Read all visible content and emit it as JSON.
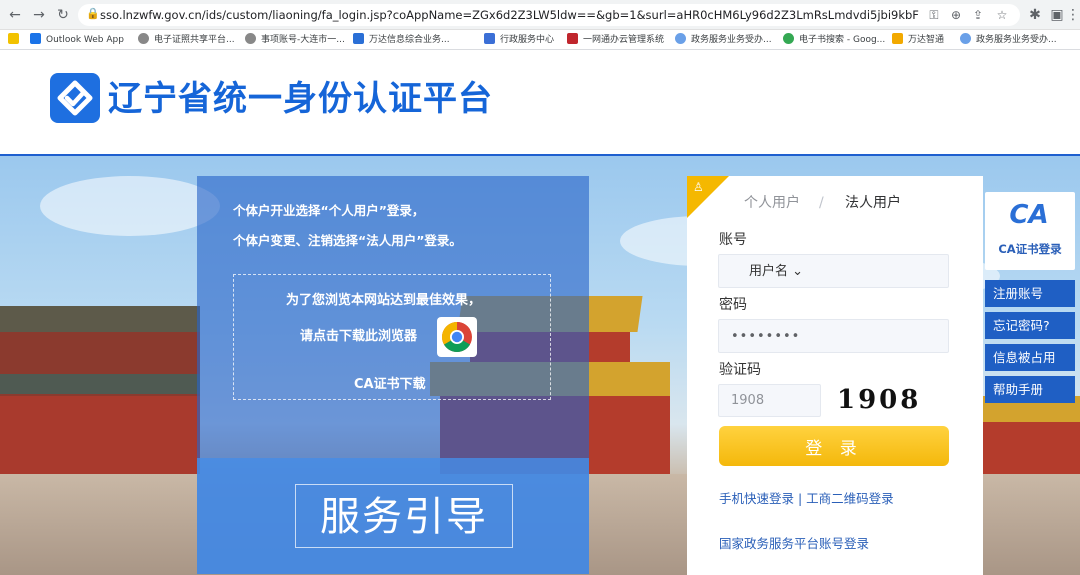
{
  "browser": {
    "url": "sso.lnzwfw.gov.cn/ids/custom/liaoning/fa_login.jsp?coAppName=ZGx6d2Z3LW5ldw==&gb=1&surl=aHR0cHM6Ly96d2Z3LmRsLmdvdi5jbi9kbFBvcnRhbC90b1VzZXJ...",
    "bookmarks": [
      "Outlook Web App",
      "电子证照共享平台...",
      "事项账号-大连市一...",
      "万达信息综合业务...",
      "行政服务中心",
      "一网通办云管理系统",
      "政务服务业务受办...",
      "电子书搜索 - Goog...",
      "万达智通",
      "政务服务业务受办..."
    ]
  },
  "header": {
    "site_title": "辽宁省统一身份认证平台"
  },
  "info_panel": {
    "line1": "个体户开业选择“个人用户”登录，",
    "line2": "个体户变更、注销选择“法人用户”登录。",
    "browser_hint_line1": "为了您浏览本网站达到最佳效果，",
    "browser_hint_line2": "请点击下载此浏览器",
    "ca_download": "CA证书下载",
    "guide_label": "服务引导"
  },
  "login": {
    "tab_personal": "个人用户",
    "tab_separator": "/",
    "tab_legal": "法人用户",
    "account_label": "账号",
    "account_type": "用户名",
    "password_label": "密码",
    "password_mask": "••••••••",
    "captcha_label": "验证码",
    "captcha_value": "1908",
    "captcha_image_text": "1908",
    "login_button": "登 录",
    "quick_links": "手机快速登录 | 工商二维码登录",
    "national_link": "国家政务服务平台账号登录"
  },
  "side": {
    "ca_logo": "CA",
    "ca_login": "CA证书登录",
    "register": "注册账号",
    "forgot": "忘记密码?",
    "info_occupied": "信息被占用",
    "help": "帮助手册"
  },
  "colors": {
    "brand_blue": "#1565d8",
    "accent_yellow": "#f4b80b",
    "side_blue": "#1f5fc4"
  }
}
